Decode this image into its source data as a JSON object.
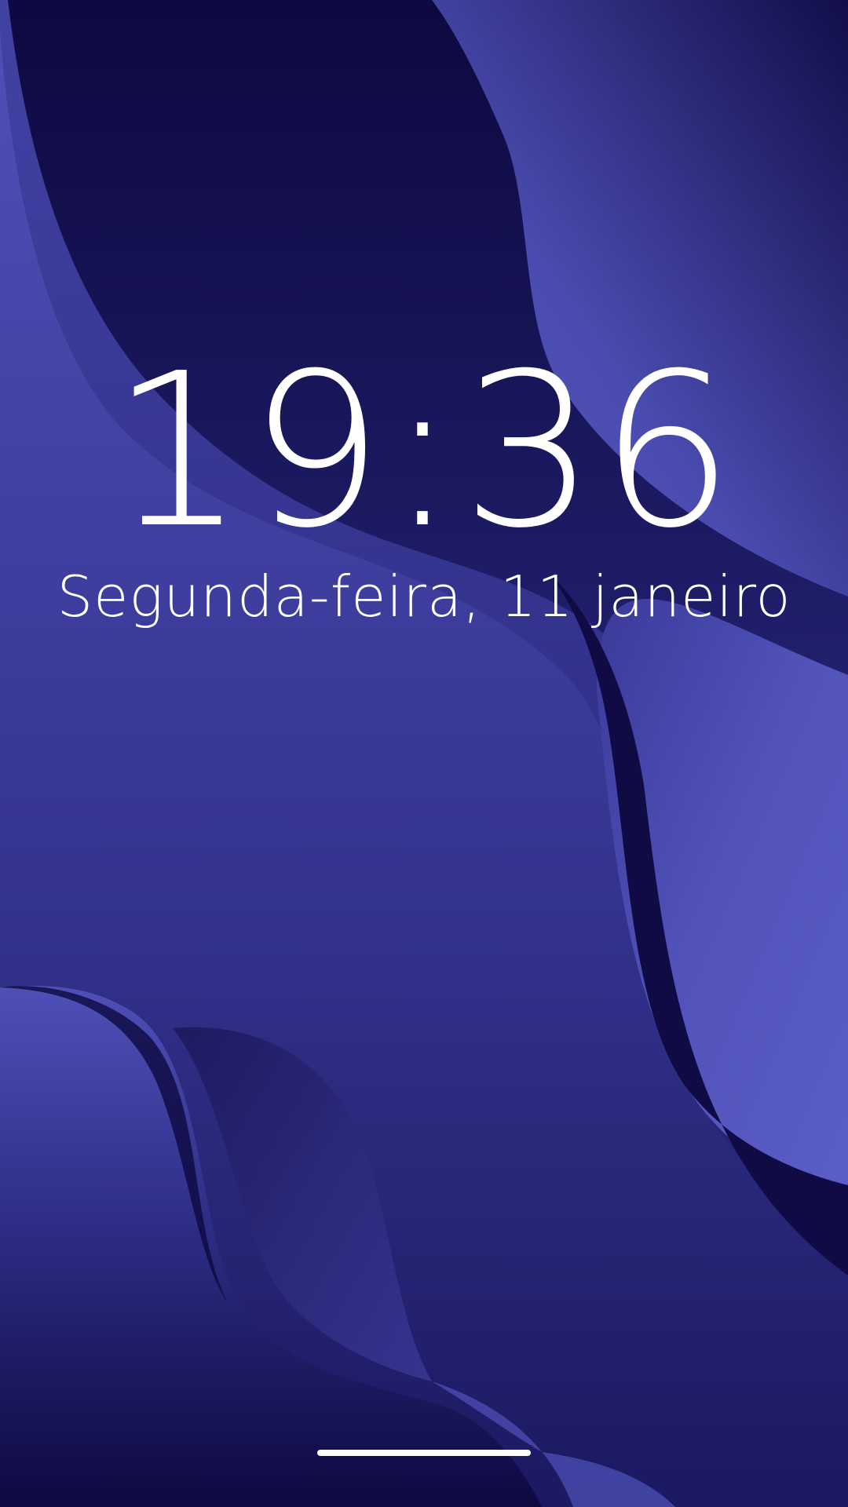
{
  "lock_screen": {
    "time": "19:36",
    "date": "Segunda-feira, 11 janeiro"
  },
  "colors": {
    "background_dark": "#0e0940",
    "background_mid": "#2a2a80",
    "wave_light": "#5a5cc8",
    "text": "#ffffff"
  }
}
